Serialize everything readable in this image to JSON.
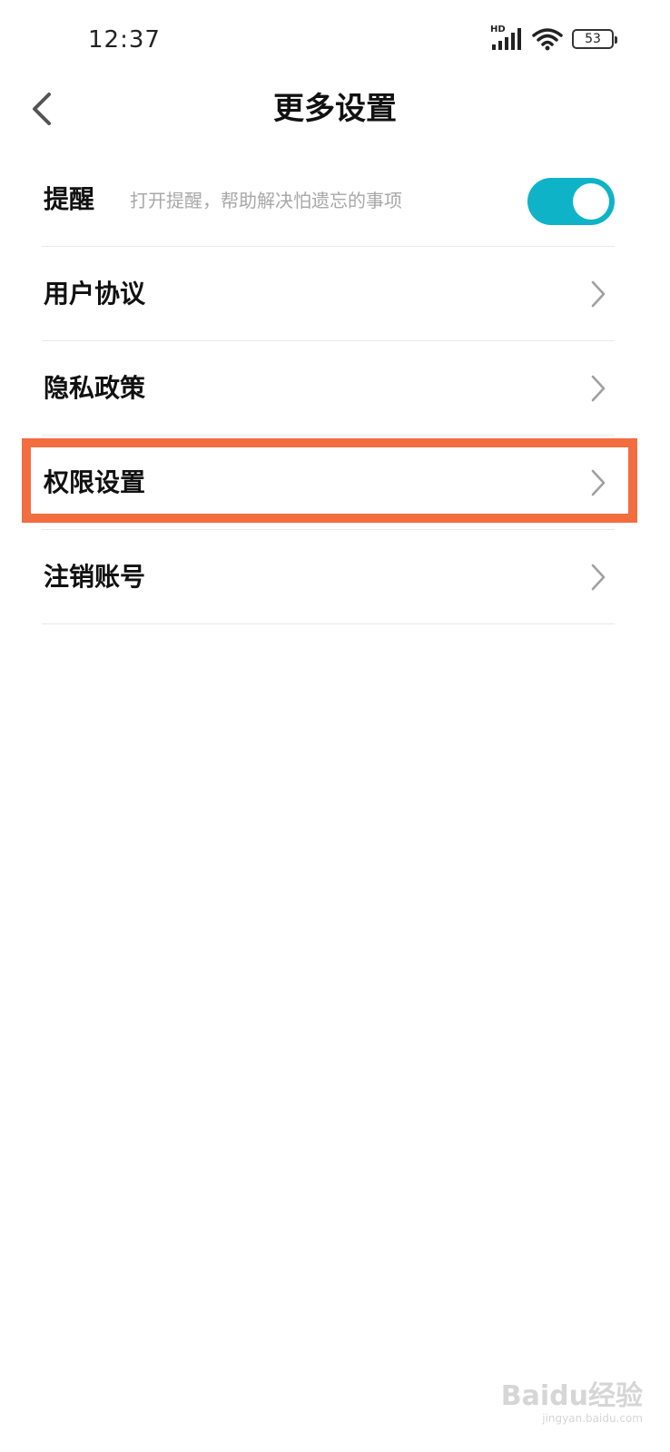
{
  "status_bar": {
    "time": "12:37",
    "network_label": "HD",
    "battery_level": "53",
    "icons": [
      "signal-icon",
      "wifi-icon",
      "battery-icon"
    ]
  },
  "header": {
    "title": "更多设置",
    "back_icon": "chevron-left-icon"
  },
  "settings": {
    "reminder": {
      "label": "提醒",
      "description": "打开提醒，帮助解决怕遗忘的事项",
      "enabled": true
    },
    "items": [
      {
        "label": "用户协议"
      },
      {
        "label": "隐私政策"
      },
      {
        "label": "权限设置"
      },
      {
        "label": "注销账号"
      }
    ]
  },
  "highlight": {
    "target": "权限设置",
    "color": "#f26d40"
  },
  "colors": {
    "accent": "#0fb3c8",
    "divider": "#e9e9e9",
    "secondary_text": "#a8a8a8"
  },
  "watermark": {
    "main": "Baidu经验",
    "sub": "jingyan.baidu.com"
  }
}
